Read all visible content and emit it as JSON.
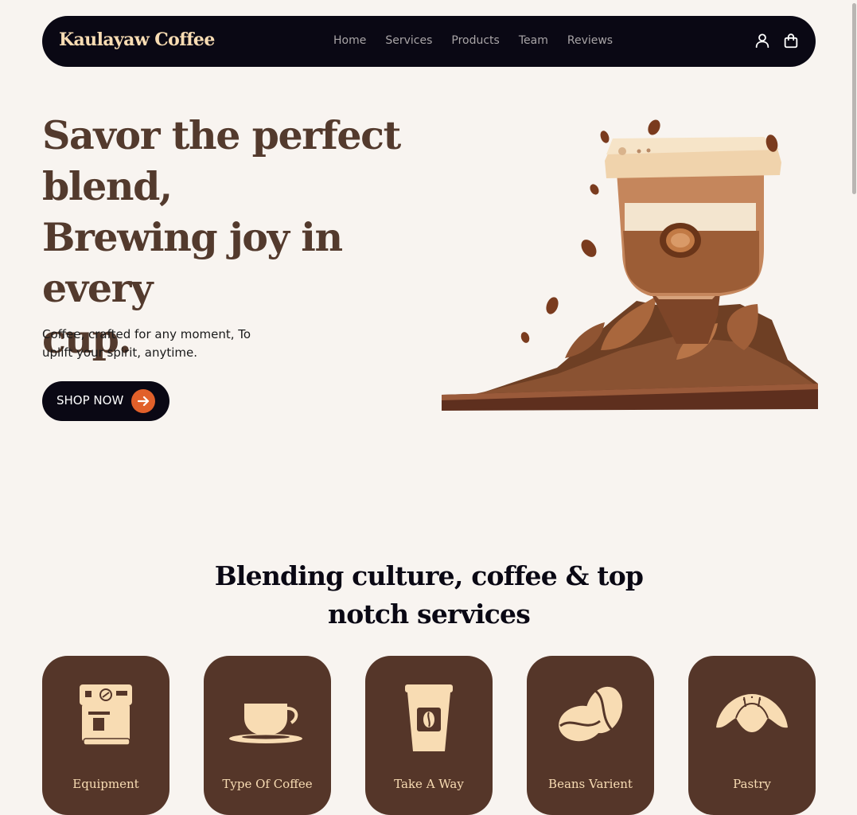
{
  "brand": "Kaulayaw Coffee",
  "nav": {
    "links": [
      "Home",
      "Services",
      "Products",
      "Team",
      "Reviews"
    ],
    "icons": [
      "user-icon",
      "shopping-bag-icon"
    ]
  },
  "hero": {
    "title_lines": [
      "Savor the perfect",
      "blend,",
      "Brewing joy in every",
      "cup."
    ],
    "subtitle": "Coffee, crafted for any moment, To uplift your spirit, anytime.",
    "cta_label": "SHOP NOW",
    "cta_icon": "arrow-right-icon",
    "image": "coffee-grinder-illustration"
  },
  "services": {
    "title": "Blending culture, coffee & top notch services",
    "cards": [
      {
        "label": "Equipment",
        "icon": "espresso-machine-icon"
      },
      {
        "label": "Type Of Coffee",
        "icon": "coffee-cup-icon"
      },
      {
        "label": "Take A Way",
        "icon": "takeaway-cup-icon"
      },
      {
        "label": "Beans Varient",
        "icon": "coffee-beans-icon"
      },
      {
        "label": "Pastry",
        "icon": "croissant-icon"
      }
    ]
  },
  "colors": {
    "background": "#f8f4f0",
    "navbar": "#0a0814",
    "brand_text": "#f8dcb3",
    "hero_title": "#533a2d",
    "card_bg": "#553629",
    "accent": "#e1602a"
  }
}
